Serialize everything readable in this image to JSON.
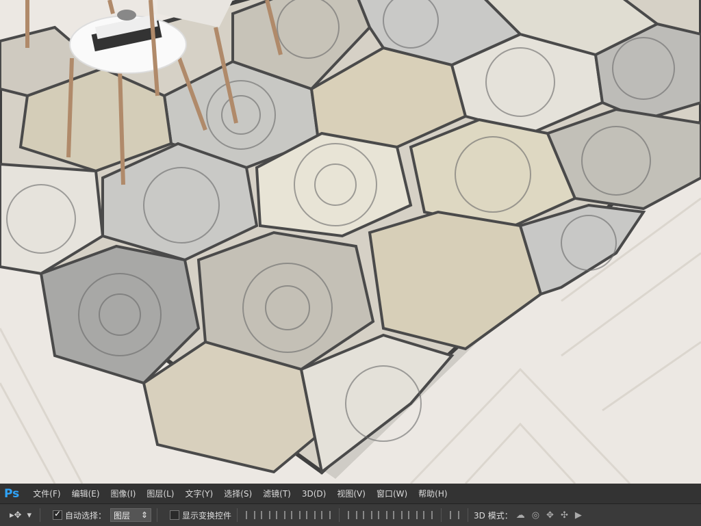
{
  "app": {
    "logo": "Ps",
    "menu": [
      "文件(F)",
      "编辑(E)",
      "图像(I)",
      "图层(L)",
      "文字(Y)",
      "选择(S)",
      "滤镜(T)",
      "3D(D)",
      "视图(V)",
      "窗口(W)",
      "帮助(H)"
    ]
  },
  "options": {
    "tool_arrow": "▸",
    "dropdown_caret": "▾",
    "auto_select_label": "自动选择：",
    "auto_select_value": "图层",
    "show_transform_label": "显示变换控件",
    "mode_label": "3D 模式："
  },
  "colors": {
    "menubar": "#333333",
    "optionbar": "#3a3a3a",
    "ps_blue": "#2fa3f7",
    "rug_border": "#3f3f3f"
  }
}
